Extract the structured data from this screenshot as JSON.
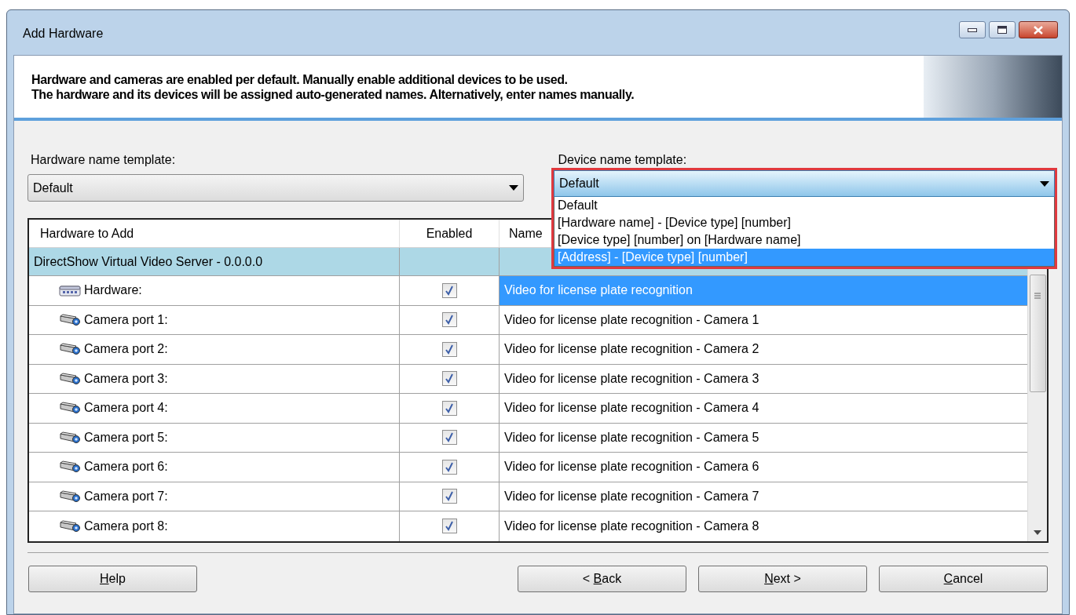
{
  "window": {
    "title": "Add Hardware"
  },
  "header": {
    "lines": [
      "Hardware and cameras are enabled per default. Manually enable additional devices to be used.",
      "The hardware and its devices will be assigned auto-generated names. Alternatively, enter names manually."
    ]
  },
  "hardware_template": {
    "label": "Hardware name template:",
    "value": "Default"
  },
  "device_template": {
    "label": "Device name template:",
    "value": "Default",
    "expanded": true,
    "options": [
      {
        "label": "Default",
        "highlighted": false
      },
      {
        "label": "[Hardware name] - [Device type] [number]",
        "highlighted": false
      },
      {
        "label": "[Device type] [number] on [Hardware name]",
        "highlighted": false
      },
      {
        "label": "[Address] - [Device type] [number]",
        "highlighted": true
      }
    ]
  },
  "table": {
    "columns": [
      "Hardware to Add",
      "Enabled",
      "Name"
    ],
    "group": "DirectShow Virtual Video Server - 0.0.0.0",
    "rows": [
      {
        "kind": "hardware",
        "label": "Hardware:",
        "enabled": true,
        "name": "Video for license plate recognition",
        "selected": true
      },
      {
        "kind": "camera",
        "label": "Camera port 1:",
        "enabled": true,
        "name": "Video for license plate recognition - Camera 1",
        "selected": false
      },
      {
        "kind": "camera",
        "label": "Camera port 2:",
        "enabled": true,
        "name": "Video for license plate recognition - Camera 2",
        "selected": false
      },
      {
        "kind": "camera",
        "label": "Camera port 3:",
        "enabled": true,
        "name": "Video for license plate recognition - Camera 3",
        "selected": false
      },
      {
        "kind": "camera",
        "label": "Camera port 4:",
        "enabled": true,
        "name": "Video for license plate recognition - Camera 4",
        "selected": false
      },
      {
        "kind": "camera",
        "label": "Camera port 5:",
        "enabled": true,
        "name": "Video for license plate recognition - Camera 5",
        "selected": false
      },
      {
        "kind": "camera",
        "label": "Camera port 6:",
        "enabled": true,
        "name": "Video for license plate recognition - Camera 6",
        "selected": false
      },
      {
        "kind": "camera",
        "label": "Camera port 7:",
        "enabled": true,
        "name": "Video for license plate recognition - Camera 7",
        "selected": false
      },
      {
        "kind": "camera",
        "label": "Camera port 8:",
        "enabled": true,
        "name": "Video for license plate recognition - Camera 8",
        "selected": false
      }
    ]
  },
  "buttons": [
    {
      "key": "H",
      "rest": "elp"
    },
    {
      "prefix": "< ",
      "key": "B",
      "rest": "ack"
    },
    {
      "key": "N",
      "rest": "ext >"
    },
    {
      "key": "C",
      "rest": "ancel"
    }
  ]
}
